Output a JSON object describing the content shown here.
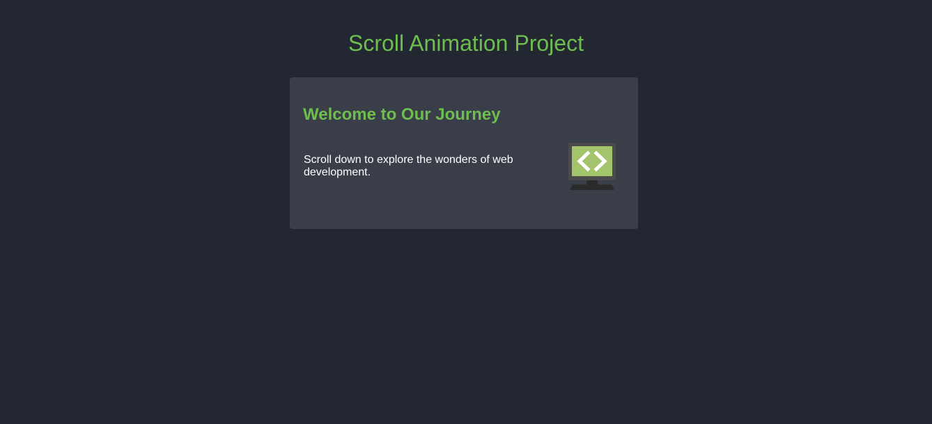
{
  "page": {
    "title": "Scroll Animation Project"
  },
  "card": {
    "heading": "Welcome to Our Journey",
    "text": "Scroll down to explore the wonders of web development.",
    "icon": "code-monitor-icon"
  },
  "colors": {
    "background": "#222731",
    "card_background": "#3a3e48",
    "accent": "#6ebe4f",
    "text": "#ffffff"
  }
}
